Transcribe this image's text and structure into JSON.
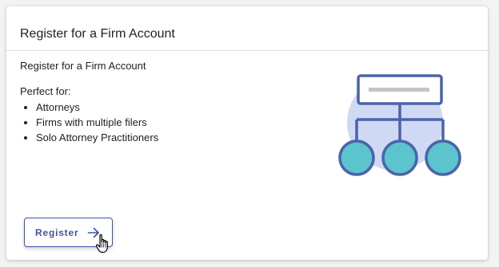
{
  "card": {
    "title": "Register for a Firm Account",
    "subtitle": "Register for a Firm Account",
    "perfect_for_label": "Perfect for:",
    "audience": [
      "Attorneys",
      "Firms with multiple filers",
      "Solo Attorney Practitioners"
    ],
    "illustration_icon": "org-hierarchy-icon",
    "register_button": {
      "label": "Register",
      "icon": "arrow-right-icon"
    }
  },
  "colors": {
    "accent": "#3d55a6",
    "illustration_bg": "#cfd9f3",
    "node_fill": "#5bc4cc",
    "node_stroke": "#4a63ab"
  }
}
